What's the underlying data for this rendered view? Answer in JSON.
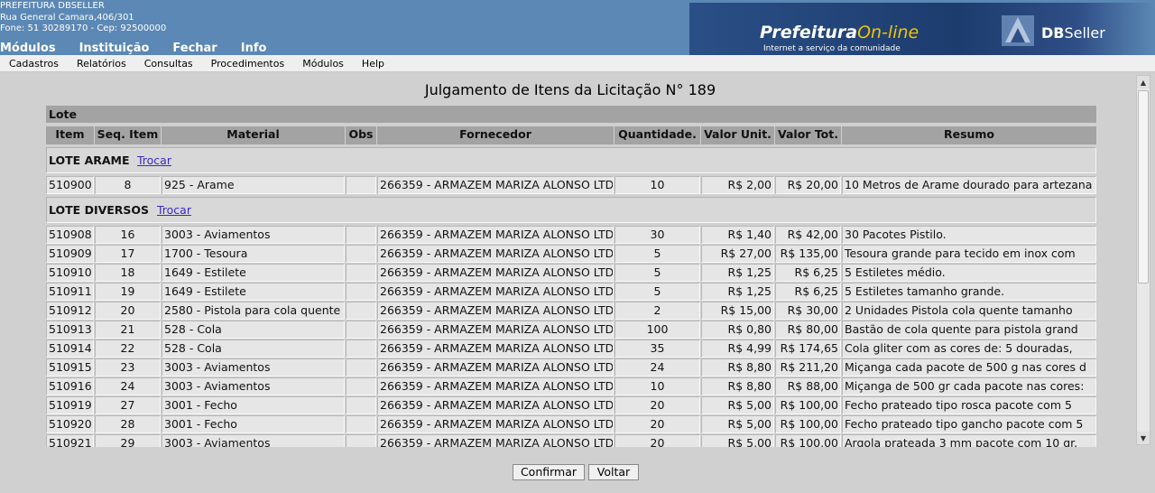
{
  "header": {
    "org_name": "PREFEITURA DBSELLER",
    "address": "Rua General Camara,406/301",
    "phone": "Fone: 51 30289170  -  Cep: 92500000",
    "nav": [
      "Módulos",
      "Instituição",
      "Fechar",
      "Info"
    ],
    "banner_title_a": "Prefeitura",
    "banner_title_b": "On-line",
    "banner_subtitle": "Internet a serviço da comunidade",
    "dbseller_a": "DB",
    "dbseller_b": "Seller"
  },
  "menubar": [
    "Cadastros",
    "Relatórios",
    "Consultas",
    "Procedimentos",
    "Módulos",
    "Help"
  ],
  "page_title": "Julgamento de Itens da Licitação N° 189",
  "table": {
    "lote_label": "Lote",
    "columns": [
      "Item",
      "Seq. Item",
      "Material",
      "Obs",
      "Fornecedor",
      "Quantidade.",
      "Valor Unit.",
      "Valor Tot.",
      "Resumo"
    ],
    "groups": [
      {
        "name": "LOTE ARAME",
        "action": "Trocar",
        "rows": [
          {
            "item": "510900",
            "seq": "8",
            "material": "925 - Arame",
            "obs": "",
            "fornecedor": "266359 - ARMAZEM MARIZA ALONSO LTDA",
            "qty": "10",
            "unit": "R$ 2,00",
            "total": "R$ 20,00",
            "resumo": "10 Metros de Arame dourado para artezana"
          }
        ]
      },
      {
        "name": "LOTE DIVERSOS",
        "action": "Trocar",
        "rows": [
          {
            "item": "510908",
            "seq": "16",
            "material": "3003 - Aviamentos",
            "obs": "",
            "fornecedor": "266359 - ARMAZEM MARIZA ALONSO LTDA",
            "qty": "30",
            "unit": "R$ 1,40",
            "total": "R$ 42,00",
            "resumo": "30 Pacotes Pistilo."
          },
          {
            "item": "510909",
            "seq": "17",
            "material": "1700 - Tesoura",
            "obs": "",
            "fornecedor": "266359 - ARMAZEM MARIZA ALONSO LTDA",
            "qty": "5",
            "unit": "R$ 27,00",
            "total": "R$ 135,00",
            "resumo": "Tesoura grande para tecido em inox com"
          },
          {
            "item": "510910",
            "seq": "18",
            "material": "1649 - Estilete",
            "obs": "",
            "fornecedor": "266359 - ARMAZEM MARIZA ALONSO LTDA",
            "qty": "5",
            "unit": "R$ 1,25",
            "total": "R$ 6,25",
            "resumo": "5 Estiletes médio."
          },
          {
            "item": "510911",
            "seq": "19",
            "material": "1649 - Estilete",
            "obs": "",
            "fornecedor": "266359 - ARMAZEM MARIZA ALONSO LTDA",
            "qty": "5",
            "unit": "R$ 1,25",
            "total": "R$ 6,25",
            "resumo": "5 Estiletes tamanho grande."
          },
          {
            "item": "510912",
            "seq": "20",
            "material": "2580 - Pistola para cola quente",
            "obs": "",
            "fornecedor": "266359 - ARMAZEM MARIZA ALONSO LTDA",
            "qty": "2",
            "unit": "R$ 15,00",
            "total": "R$ 30,00",
            "resumo": "2 Unidades Pistola cola quente tamanho"
          },
          {
            "item": "510913",
            "seq": "21",
            "material": "528 - Cola",
            "obs": "",
            "fornecedor": "266359 - ARMAZEM MARIZA ALONSO LTDA",
            "qty": "100",
            "unit": "R$ 0,80",
            "total": "R$ 80,00",
            "resumo": "Bastão de cola quente para pistola grand"
          },
          {
            "item": "510914",
            "seq": "22",
            "material": "528 - Cola",
            "obs": "",
            "fornecedor": "266359 - ARMAZEM MARIZA ALONSO LTDA",
            "qty": "35",
            "unit": "R$ 4,99",
            "total": "R$ 174,65",
            "resumo": "Cola gliter com as cores de: 5 douradas,"
          },
          {
            "item": "510915",
            "seq": "23",
            "material": "3003 - Aviamentos",
            "obs": "",
            "fornecedor": "266359 - ARMAZEM MARIZA ALONSO LTDA",
            "qty": "24",
            "unit": "R$ 8,80",
            "total": "R$ 211,20",
            "resumo": "Miçanga cada pacote de 500 g nas cores d"
          },
          {
            "item": "510916",
            "seq": "24",
            "material": "3003 - Aviamentos",
            "obs": "",
            "fornecedor": "266359 - ARMAZEM MARIZA ALONSO LTDA",
            "qty": "10",
            "unit": "R$ 8,80",
            "total": "R$ 88,00",
            "resumo": "Miçanga de 500 gr cada pacote nas cores:"
          },
          {
            "item": "510919",
            "seq": "27",
            "material": "3001 - Fecho",
            "obs": "",
            "fornecedor": "266359 - ARMAZEM MARIZA ALONSO LTDA",
            "qty": "20",
            "unit": "R$ 5,00",
            "total": "R$ 100,00",
            "resumo": "Fecho prateado tipo rosca pacote com 5"
          },
          {
            "item": "510920",
            "seq": "28",
            "material": "3001 - Fecho",
            "obs": "",
            "fornecedor": "266359 - ARMAZEM MARIZA ALONSO LTDA",
            "qty": "20",
            "unit": "R$ 5,00",
            "total": "R$ 100,00",
            "resumo": "Fecho prateado tipo gancho pacote com 5"
          },
          {
            "item": "510921",
            "seq": "29",
            "material": "3003 - Aviamentos",
            "obs": "",
            "fornecedor": "266359 - ARMAZEM MARIZA ALONSO LTDA",
            "qty": "20",
            "unit": "R$ 5,00",
            "total": "R$ 100,00",
            "resumo": "Argola prateada 3 mm pacote com 10 gr."
          }
        ]
      }
    ]
  },
  "buttons": {
    "confirm": "Confirmar",
    "back": "Voltar"
  }
}
